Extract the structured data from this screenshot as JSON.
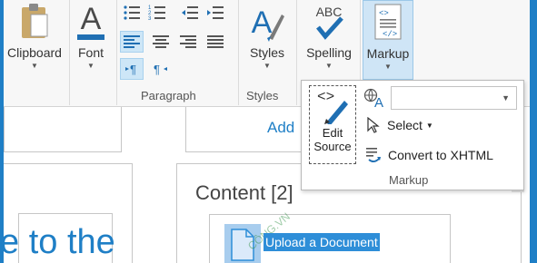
{
  "ribbon": {
    "clipboard": {
      "label": "Clipboard",
      "icon": "clipboard-icon"
    },
    "font": {
      "label": "Font",
      "icon": "font-color-icon",
      "accent": "#1f6fb3"
    },
    "paragraph": {
      "group_label": "Paragraph"
    },
    "styles": {
      "label": "Styles",
      "group_label": "Styles",
      "icon": "styles-icon"
    },
    "spelling": {
      "label": "Spelling",
      "icon_text": "ABC"
    },
    "markup": {
      "label": "Markup",
      "icon": "markup-icon"
    }
  },
  "markup_menu": {
    "edit_source_line1": "Edit",
    "edit_source_line2": "Source",
    "language_value": "",
    "select_label": "Select",
    "convert_label": "Convert to XHTML",
    "group_label": "Markup"
  },
  "page": {
    "add_link": "Add",
    "content_heading": "Content [2]",
    "title_fragment": "e to the",
    "upload_label": "Upload a Document",
    "watermark": "CÔNG.VN"
  },
  "colors": {
    "accent": "#1f7fc6",
    "selection": "#2e8ed8",
    "ribbon_bg": "#f7f7f7"
  }
}
